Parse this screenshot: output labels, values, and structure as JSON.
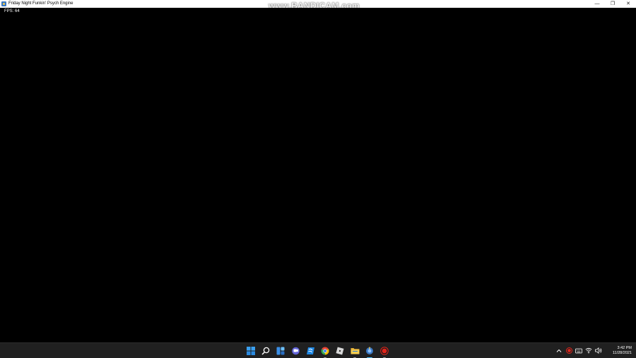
{
  "window": {
    "title": "Friday Night Funkin' Psych Engine",
    "minimize_glyph": "—",
    "maximize_glyph": "❐",
    "close_glyph": "✕"
  },
  "watermark": "www.BANDICAM.com",
  "game": {
    "fps_text": "FPS: 64"
  },
  "taskbar": {
    "apps": [
      {
        "icon": "windows-start-icon",
        "indicator": "none"
      },
      {
        "icon": "search-icon",
        "indicator": "none"
      },
      {
        "icon": "widgets-icon",
        "indicator": "none"
      },
      {
        "icon": "teams-chat-icon",
        "indicator": "none"
      },
      {
        "icon": "microsoft-store-icon",
        "indicator": "none"
      },
      {
        "icon": "chrome-icon",
        "indicator": "running"
      },
      {
        "icon": "roblox-icon",
        "indicator": "none"
      },
      {
        "icon": "file-explorer-icon",
        "indicator": "running"
      },
      {
        "icon": "fnf-psych-engine-icon",
        "indicator": "active"
      },
      {
        "icon": "bandicam-record-icon",
        "indicator": "running"
      }
    ],
    "tray": {
      "icons": [
        "chevron-up-icon",
        "bandicam-tray-icon",
        "keyboard-icon",
        "wifi-icon",
        "volume-icon"
      ],
      "time": "3:42 PM",
      "date": "11/28/2021"
    }
  },
  "colors": {
    "game_background": "#000000",
    "titlebar": "#ffffff",
    "taskbar": "#202020",
    "active_indicator": "#4cc2ff",
    "bandicam_red": "#e0241a"
  }
}
